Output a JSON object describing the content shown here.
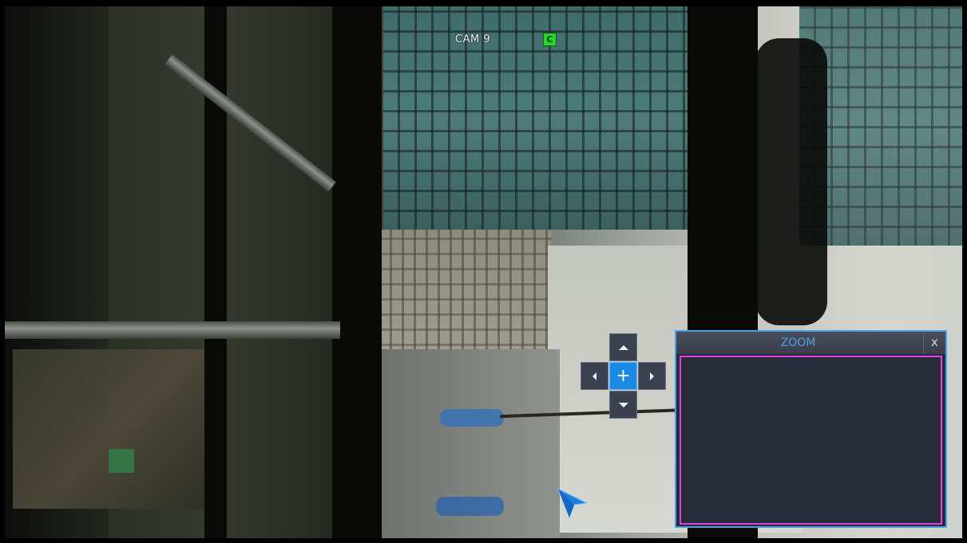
{
  "osd": {
    "camera_label": "CAM 9",
    "status_badge": "C",
    "status_badge_color": "#22d62a"
  },
  "ptz": {
    "up_icon": "arrow-up-icon",
    "down_icon": "arrow-down-icon",
    "left_icon": "arrow-left-icon",
    "right_icon": "arrow-right-icon",
    "center_label": "+",
    "center_color": "#1b8ae4"
  },
  "zoom_panel": {
    "title": "ZOOM",
    "close_label": "x",
    "accent_color": "#4aa3df",
    "selection_border_color": "#e33fe0"
  },
  "cursor": {
    "icon": "mouse-pointer-icon",
    "color": "#1d7fe0"
  }
}
